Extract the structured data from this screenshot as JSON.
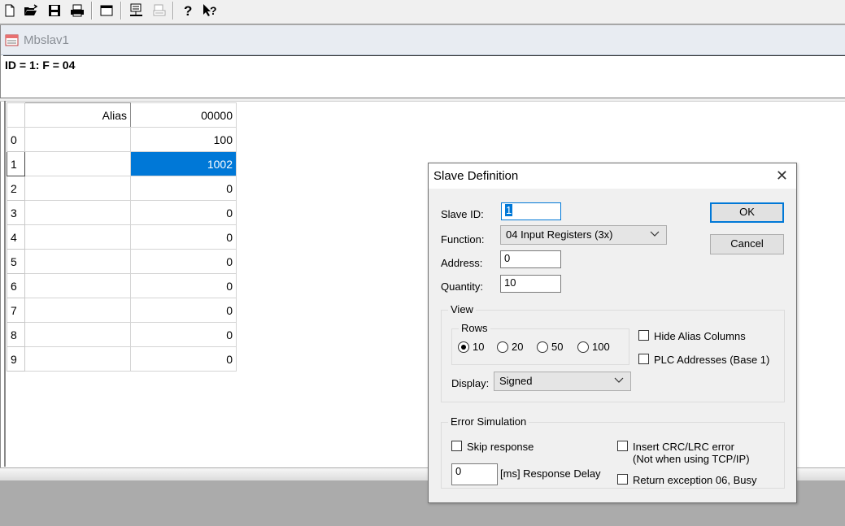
{
  "toolbar": {
    "icons": [
      "new-icon",
      "open-icon",
      "save-icon",
      "print-icon",
      "window-icon",
      "connect-icon",
      "disconnect-icon",
      "help-icon",
      "context-help-icon"
    ]
  },
  "window": {
    "title": "Mbslav1",
    "info": "ID = 1: F = 04"
  },
  "grid": {
    "headers": {
      "alias": "Alias",
      "value": "00000"
    },
    "rows": [
      {
        "index": "0",
        "alias": "",
        "value": "100"
      },
      {
        "index": "1",
        "alias": "",
        "value": "1002"
      },
      {
        "index": "2",
        "alias": "",
        "value": "0"
      },
      {
        "index": "3",
        "alias": "",
        "value": "0"
      },
      {
        "index": "4",
        "alias": "",
        "value": "0"
      },
      {
        "index": "5",
        "alias": "",
        "value": "0"
      },
      {
        "index": "6",
        "alias": "",
        "value": "0"
      },
      {
        "index": "7",
        "alias": "",
        "value": "0"
      },
      {
        "index": "8",
        "alias": "",
        "value": "0"
      },
      {
        "index": "9",
        "alias": "",
        "value": "0"
      }
    ],
    "selected_row": 1
  },
  "dialog": {
    "title": "Slave Definition",
    "close": "✕",
    "slave_id_label": "Slave ID:",
    "slave_id_value": "1",
    "function_label": "Function:",
    "function_value": "04 Input Registers (3x)",
    "address_label": "Address:",
    "address_value": "0",
    "quantity_label": "Quantity:",
    "quantity_value": "10",
    "ok": "OK",
    "cancel": "Cancel",
    "view_group": "View",
    "rows_group": "Rows",
    "rows_options": [
      {
        "label": "10",
        "checked": true
      },
      {
        "label": "20",
        "checked": false
      },
      {
        "label": "50",
        "checked": false
      },
      {
        "label": "100",
        "checked": false
      }
    ],
    "hide_alias": {
      "label": "Hide Alias Columns",
      "checked": false
    },
    "plc_addresses": {
      "label": "PLC Addresses (Base 1)",
      "checked": false
    },
    "display_label": "Display:",
    "display_value": "Signed",
    "error_group": "Error Simulation",
    "skip_response": {
      "label": "Skip response",
      "checked": false
    },
    "insert_crc": {
      "label": "Insert CRC/LRC error",
      "checked": false
    },
    "insert_crc_note": "(Not when using TCP/IP)",
    "response_delay_value": "0",
    "response_delay_label": "[ms] Response Delay",
    "return_exception": {
      "label": "Return exception 06, Busy",
      "checked": false
    }
  },
  "colors": {
    "selection": "#0078d7",
    "dialog_bg": "#f0f0f0",
    "workspace_bg": "#ababab"
  }
}
